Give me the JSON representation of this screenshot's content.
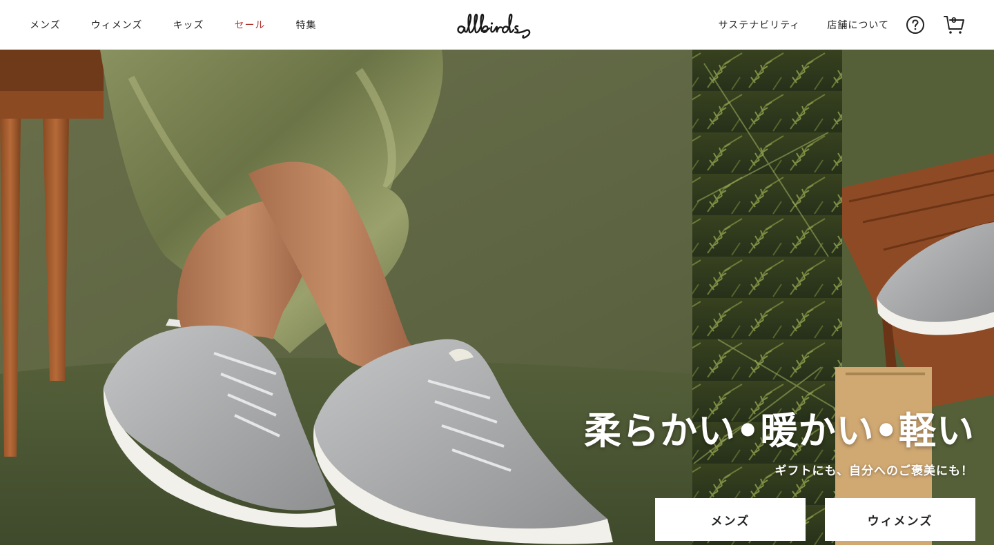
{
  "header": {
    "nav_left": [
      {
        "label": "メンズ"
      },
      {
        "label": "ウィメンズ"
      },
      {
        "label": "キッズ"
      },
      {
        "label": "セール"
      },
      {
        "label": "特集"
      }
    ],
    "logo_text": "allbirds",
    "nav_right": {
      "sustainability": "サステナビリティ",
      "stores": "店舗について"
    },
    "help_icon": "help-circle-icon",
    "cart_icon": "cart-icon",
    "cart_count": "0"
  },
  "hero": {
    "headline": "柔らかい•暖かい•軽い",
    "subline": "ギフトにも、自分へのご褒美にも！",
    "buttons": {
      "mens": "メンズ",
      "womens": "ウィメンズ"
    }
  },
  "colors": {
    "sale_text": "#b0302b",
    "hero_background": "#5b6340",
    "button_background": "#ffffff"
  }
}
